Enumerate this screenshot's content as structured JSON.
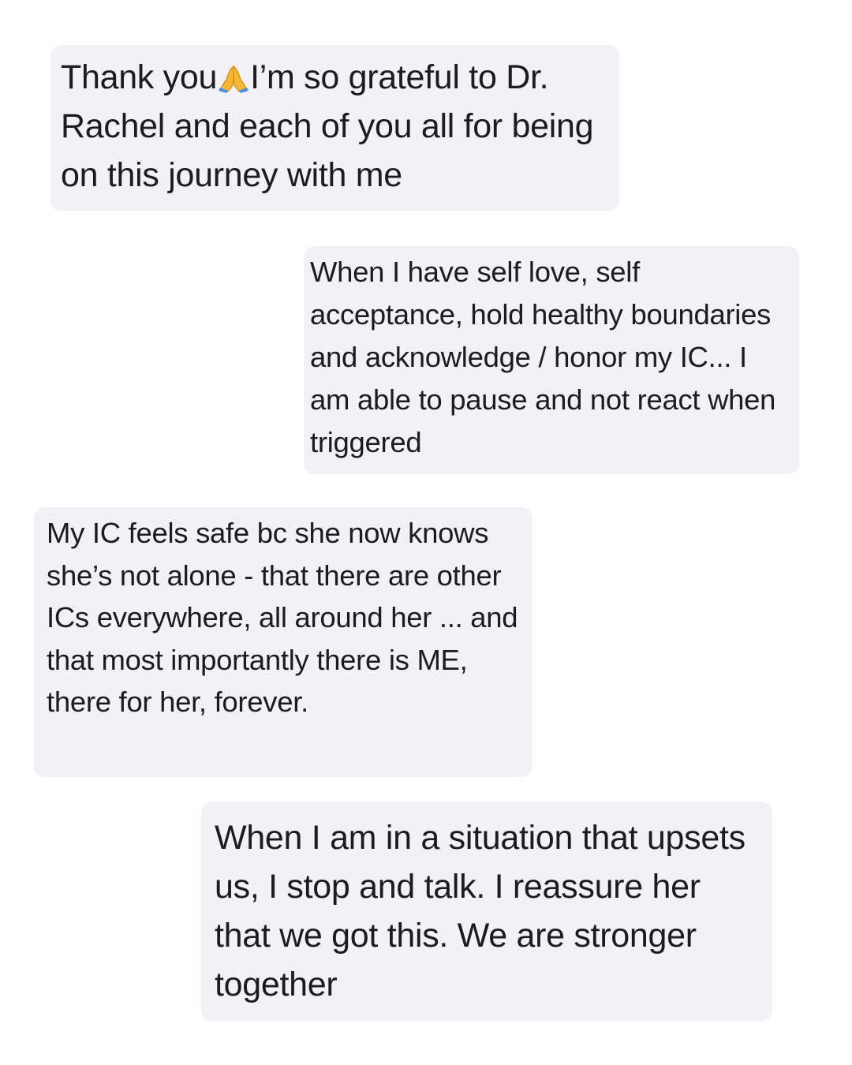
{
  "messages": [
    {
      "text_before_icon": "Thank you",
      "icon": "folded-hands-emoji",
      "text_after_icon": "I’m so grateful to Dr. Rachel and each of you all for being on this journey with me"
    },
    {
      "text": "When I have self love, self acceptance, hold healthy boundaries and acknowledge / honor my IC... I am able to pause and not react when triggered"
    },
    {
      "text": "My IC feels safe bc she now knows she’s not alone - that there are other ICs everywhere, all around her ... and that most importantly there is ME, there for her, forever."
    },
    {
      "text": "When I am in a situation that upsets us, I stop and talk. I reassure her that we got this. We are stronger together"
    }
  ],
  "colors": {
    "background": "#ffffff",
    "bubble": "#f1f1f6",
    "text": "#1c1c1e",
    "emoji_hands": "#f7b733",
    "emoji_sleeve": "#4a90e2"
  }
}
